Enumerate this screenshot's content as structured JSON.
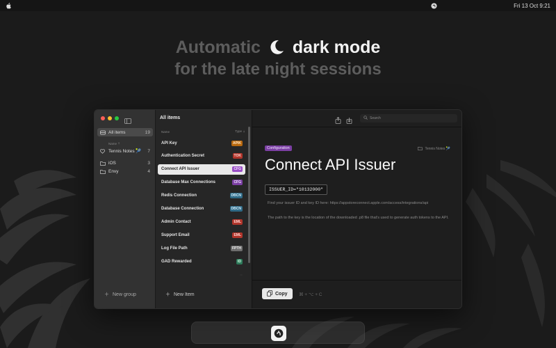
{
  "menubar": {
    "datetime": "Fri 13 Oct  9:21"
  },
  "headline": {
    "line1_prefix": "Automatic",
    "line1_suffix": "dark mode",
    "line2": "for the late night sessions"
  },
  "window": {
    "traffic_colors": [
      "#ff5f57",
      "#febc2e",
      "#28c840"
    ],
    "sidebar": {
      "all_items": {
        "label": "All items",
        "count": "19"
      },
      "section_header": "Name ⇡",
      "items": [
        {
          "label": "Tennis Notes 🎾",
          "count": "7"
        },
        {
          "label": "iOS",
          "count": "3"
        },
        {
          "label": "Envy",
          "count": "4"
        }
      ],
      "new_group": "New group"
    },
    "list": {
      "title": "All items",
      "col_name": "Name",
      "col_type": "Type ⇣",
      "rows": [
        {
          "label": "API Key",
          "badge": "APIK",
          "bg": "#b8680e",
          "fg": "#ffe8c8"
        },
        {
          "label": "Authentication Secret",
          "badge": "TOK",
          "bg": "#b0352b",
          "fg": "#ffd8d4"
        },
        {
          "label": "Connect API Issuer",
          "badge": "CFG",
          "bg": "#9a4ec7",
          "fg": "#f4e4ff"
        },
        {
          "label": "Database Max Connections",
          "badge": "CFG",
          "bg": "#7b3fa3",
          "fg": "#f0e4ff"
        },
        {
          "label": "Redis Connection",
          "badge": "DBCN",
          "bg": "#2f6a86",
          "fg": "#d6f0ff"
        },
        {
          "label": "Database Connection",
          "badge": "DBCN",
          "bg": "#2f6a86",
          "fg": "#d6f0ff"
        },
        {
          "label": "Admin Contact",
          "badge": "EML",
          "bg": "#b0352b",
          "fg": "#ffd8d4"
        },
        {
          "label": "Support Email",
          "badge": "EML",
          "bg": "#b0352b",
          "fg": "#ffd8d4"
        },
        {
          "label": "Log File Path",
          "badge": "FPTH",
          "bg": "#6e6e6e",
          "fg": "#f0f0f0"
        },
        {
          "label": "GAD Rewarded",
          "badge": "ID",
          "bg": "#2e7a5a",
          "fg": "#d8ffe8"
        },
        {
          "label": "",
          "badge": "",
          "bg": "#444",
          "fg": "#aaa"
        }
      ],
      "new_item": "New Item"
    },
    "detail": {
      "search_placeholder": "Search",
      "chip": "Configuration",
      "folder": "Tennis Notes 🎾",
      "title": "Connect API Issuer",
      "value": "ISSUER_ID=\"10132000\"",
      "note1": "Find your issuer ID and key ID here: https://appstoreconnect.apple.com/access/integrations/api",
      "note2": "The path to the key is the location of the downloaded .p8 file that's used to generate auth tokens to the API.",
      "copy": "Copy",
      "shortcut": "⌘ + ⌥ + C"
    }
  }
}
